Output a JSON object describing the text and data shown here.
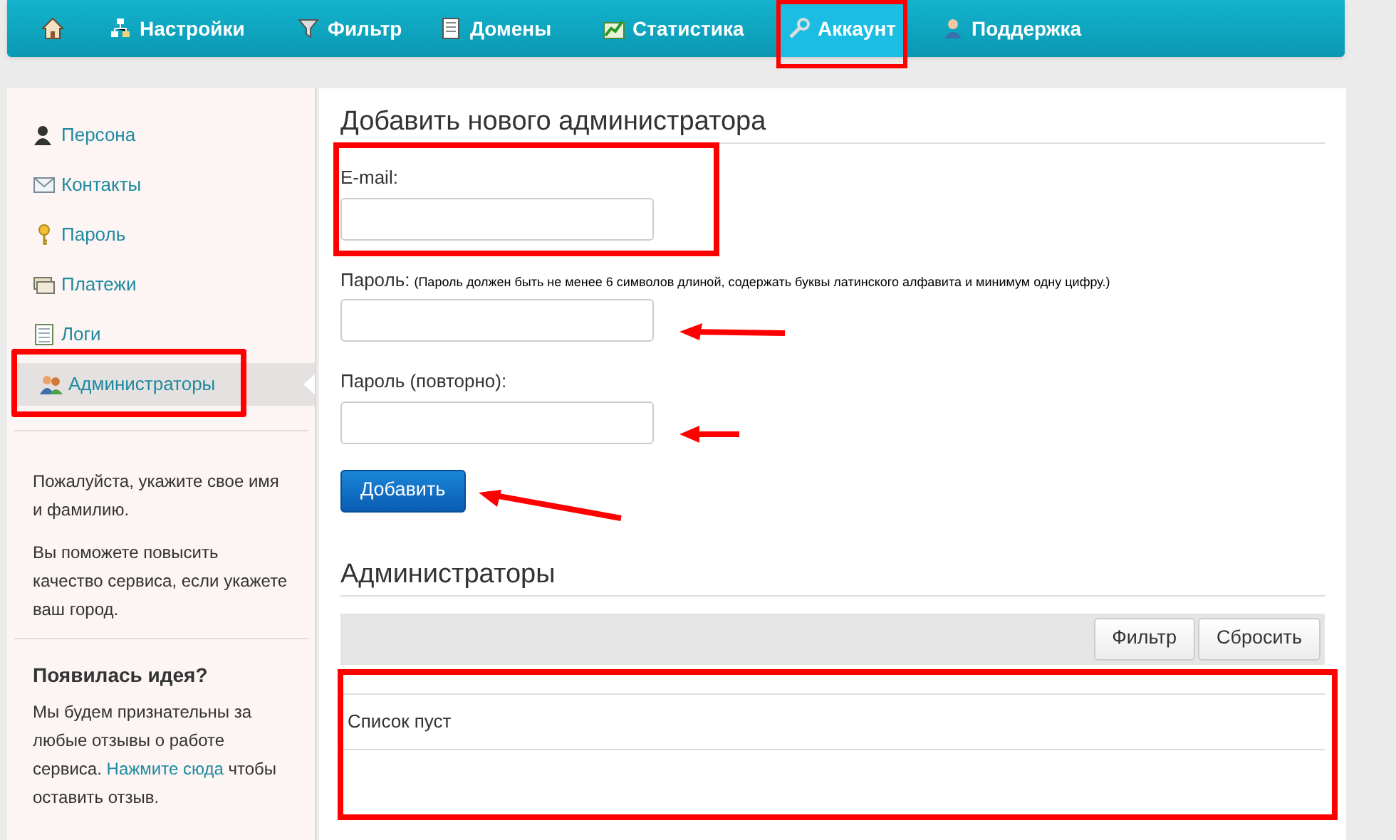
{
  "nav": [
    {
      "kind": "home",
      "selected": false,
      "highlighted": false
    },
    {
      "kind": "link",
      "label": "Настройки",
      "selected": false,
      "highlighted": false
    },
    {
      "kind": "link",
      "label": "Фильтр",
      "selected": false,
      "highlighted": false
    },
    {
      "kind": "link",
      "label": "Домены",
      "selected": false,
      "highlighted": false
    },
    {
      "kind": "link",
      "label": "Статистика",
      "selected": false,
      "highlighted": false
    },
    {
      "kind": "link",
      "label": "Аккаунт",
      "selected": true,
      "highlighted": true
    },
    {
      "kind": "link",
      "label": "Поддержка",
      "selected": false,
      "highlighted": false
    }
  ],
  "sidebar": {
    "items": [
      {
        "label": "Персона",
        "selected": false,
        "highlighted": false
      },
      {
        "label": "Контакты",
        "selected": false,
        "highlighted": false
      },
      {
        "label": "Пароль",
        "selected": false,
        "highlighted": false
      },
      {
        "label": "Платежи",
        "selected": false,
        "highlighted": false
      },
      {
        "label": "Логи",
        "selected": false,
        "highlighted": false
      },
      {
        "label": "Администраторы",
        "selected": true,
        "highlighted": true
      }
    ],
    "notes": [
      "Пожалуйста, укажите свое имя и фамилию.",
      "Вы поможете повысить качество сервиса, если укажете ваш город."
    ],
    "idea": {
      "title": "Появилась идея?",
      "text": "Мы будем признательны за любые отзывы о работе сервиса.",
      "link": "Нажмите сюда",
      "text_after": "чтобы оставить отзыв."
    }
  },
  "form": {
    "title": "Добавить нового администратора",
    "fields": [
      {
        "label": "E-mail:",
        "highlighted": true,
        "arrow": false
      },
      {
        "label": "Пароль:",
        "hint": "(Пароль должен быть не менее 6 символов длиной, содержать буквы латинского алфавита и минимум одну цифру.)",
        "highlighted": false,
        "arrow": true
      },
      {
        "label": "Пароль (повторно):",
        "highlighted": false,
        "arrow": true
      }
    ],
    "submit": {
      "label": "Добавить",
      "arrow": true
    }
  },
  "admins": {
    "title": "Администраторы",
    "toolbar_buttons": [
      "Фильтр",
      "Сбросить"
    ],
    "list": {
      "empty_text": "Список пуст",
      "highlighted": true
    }
  }
}
